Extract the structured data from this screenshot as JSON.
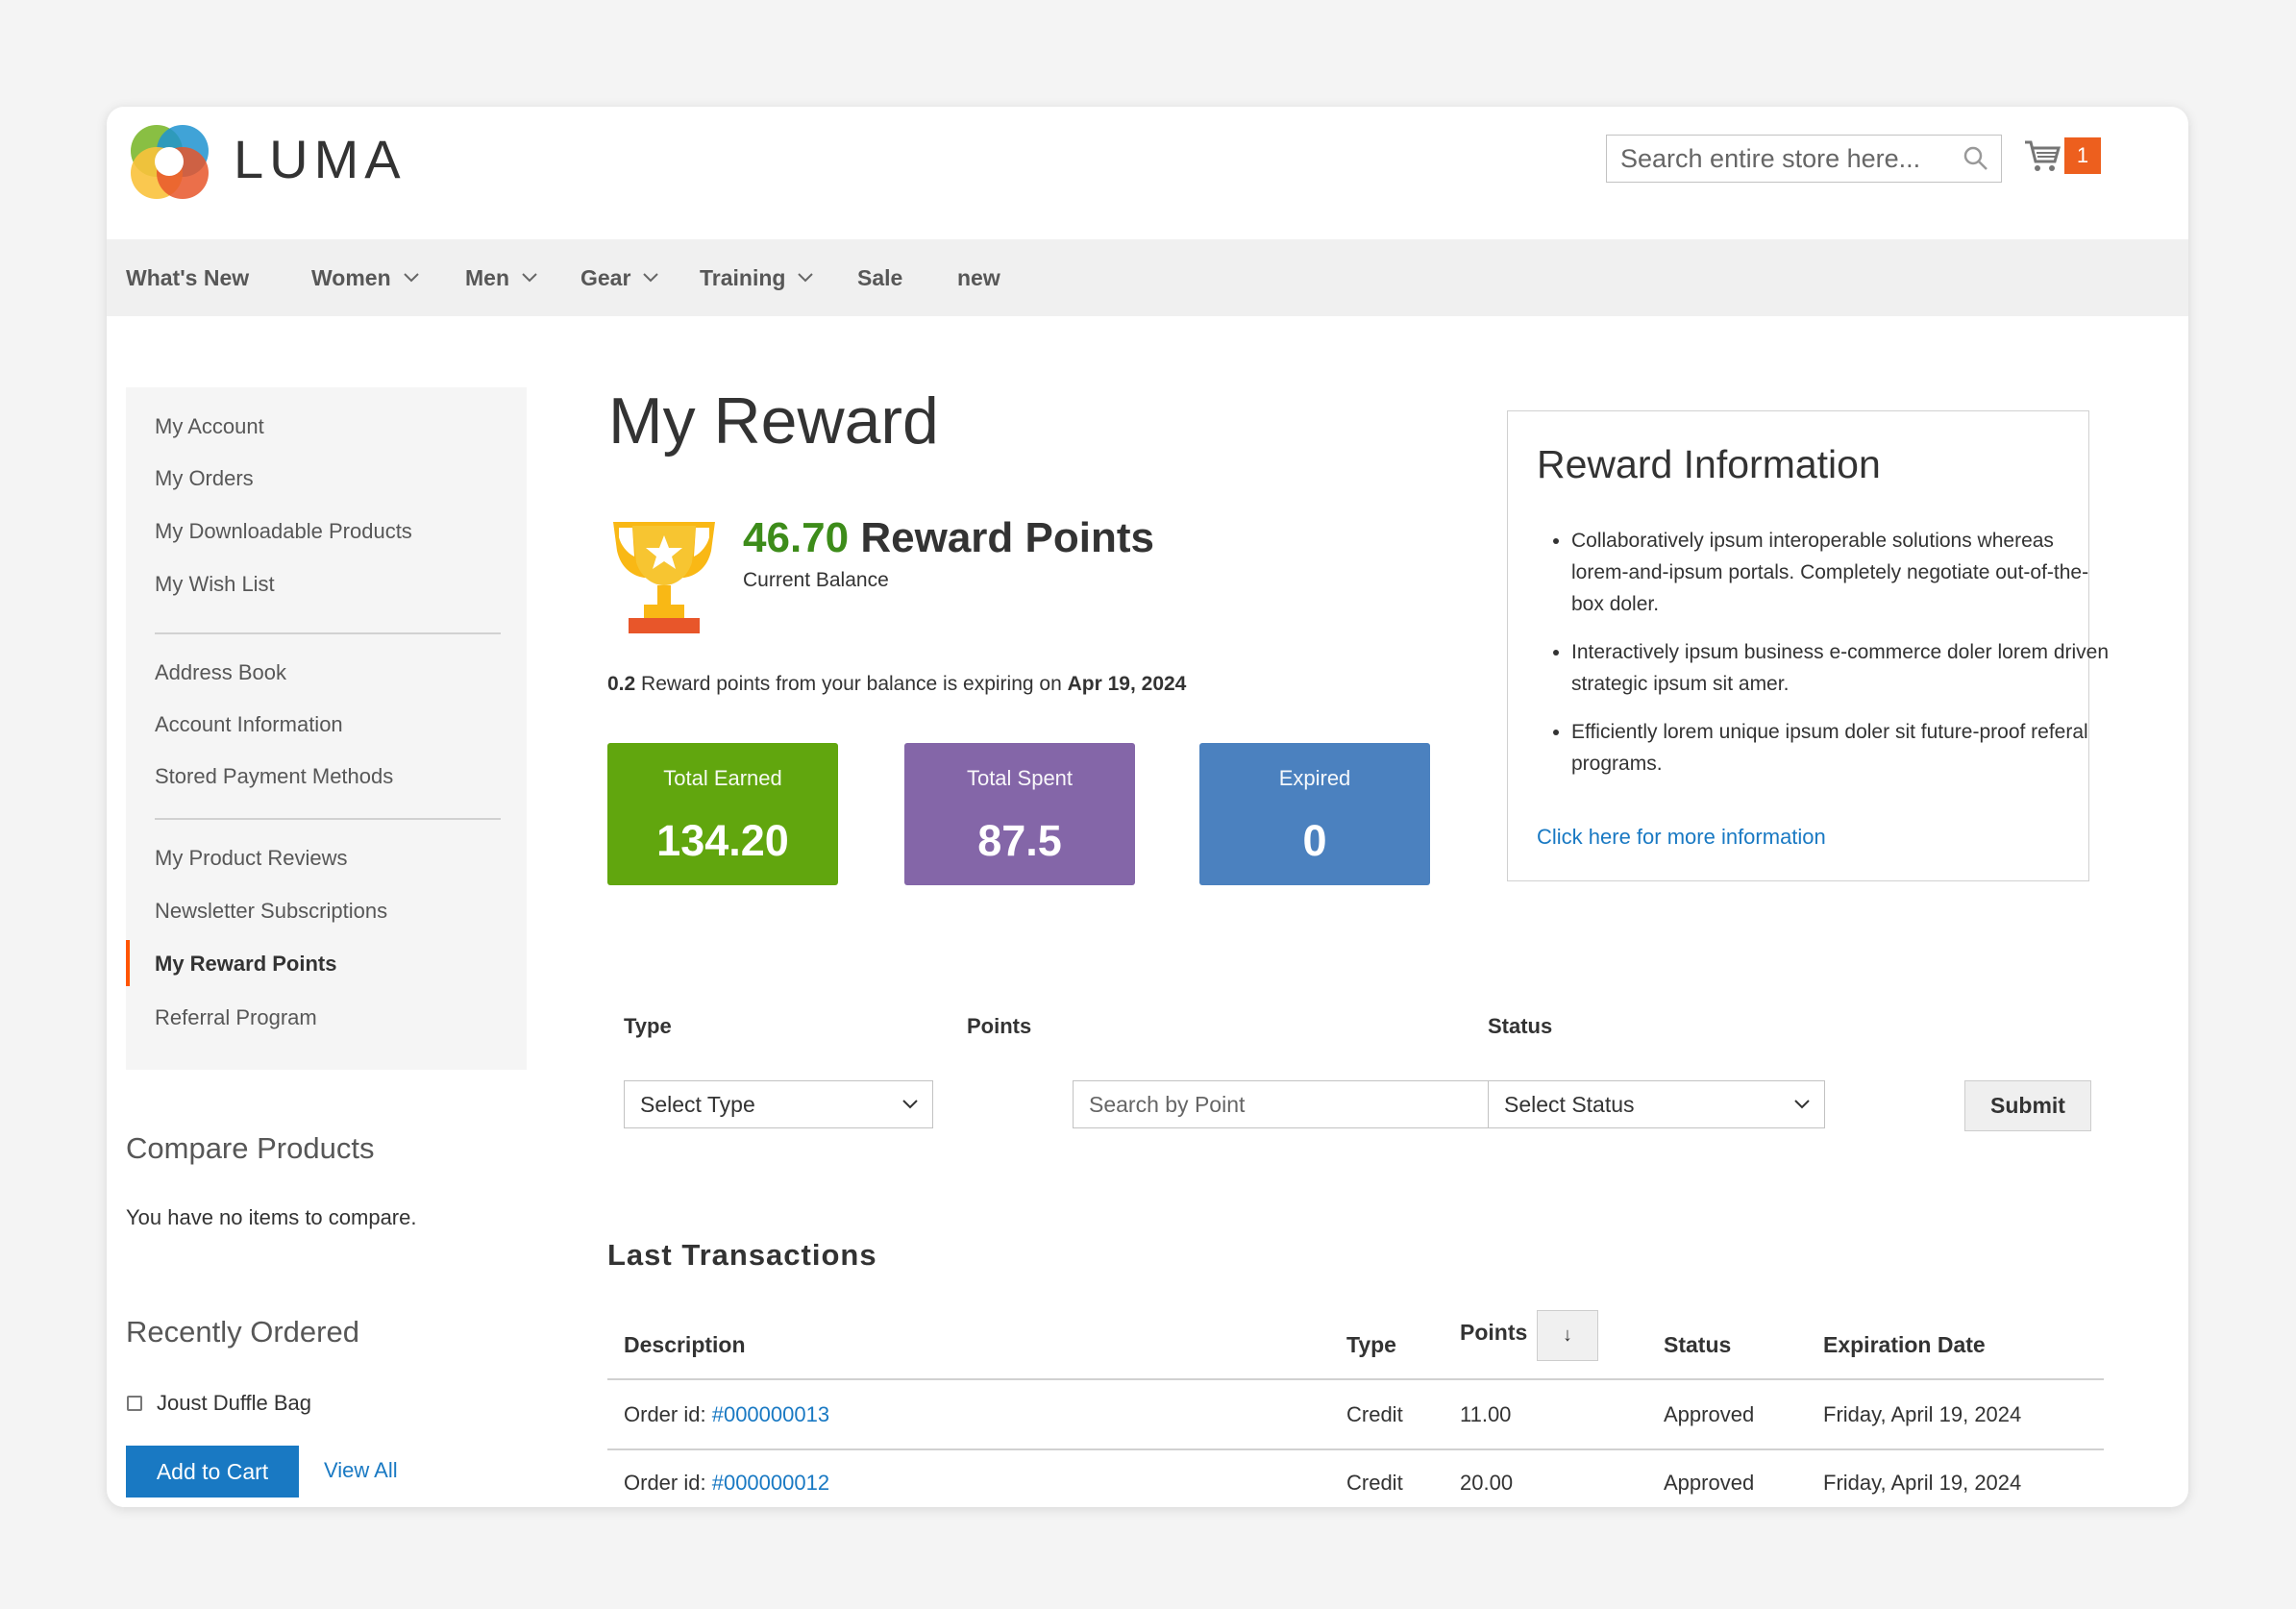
{
  "header": {
    "logo_text": "LUMA",
    "search_placeholder": "Search entire store here...",
    "cart_count": "1"
  },
  "nav": {
    "items": [
      {
        "label": "What's New",
        "has_dropdown": false
      },
      {
        "label": "Women",
        "has_dropdown": true
      },
      {
        "label": "Men",
        "has_dropdown": true
      },
      {
        "label": "Gear",
        "has_dropdown": true
      },
      {
        "label": "Training",
        "has_dropdown": true
      },
      {
        "label": "Sale",
        "has_dropdown": false
      },
      {
        "label": "new",
        "has_dropdown": false
      }
    ]
  },
  "sidebar": {
    "items": [
      {
        "label": "My Account"
      },
      {
        "label": "My Orders"
      },
      {
        "label": "My Downloadable Products"
      },
      {
        "label": "My Wish List"
      },
      {
        "label": "Address Book"
      },
      {
        "label": "Account Information"
      },
      {
        "label": "Stored Payment Methods"
      },
      {
        "label": "My Product Reviews"
      },
      {
        "label": "Newsletter Subscriptions"
      },
      {
        "label": "My Reward Points",
        "active": true
      },
      {
        "label": "Referral Program"
      }
    ]
  },
  "compare": {
    "title": "Compare Products",
    "empty_text": "You have no items to compare."
  },
  "recently_ordered": {
    "title": "Recently Ordered",
    "item": "Joust Duffle Bag",
    "add_to_cart": "Add to Cart",
    "view_all": "View All"
  },
  "main": {
    "title": "My Reward",
    "balance_value": "46.70",
    "balance_unit": "Reward Points",
    "balance_label": "Current Balance",
    "expire_amount": "0.2",
    "expire_text": "Reward points from your balance is expiring on",
    "expire_date": "Apr 19, 2024"
  },
  "stats": [
    {
      "label": "Total Earned",
      "value": "134.20",
      "color": "#61a60e"
    },
    {
      "label": "Total Spent",
      "value": "87.5",
      "color": "#8466a8"
    },
    {
      "label": "Expired",
      "value": "0",
      "color": "#4b81bf"
    }
  ],
  "reward_info": {
    "title": "Reward Information",
    "bullets": [
      "Collaboratively ipsum interoperable solutions whereas lorem-and-ipsum portals. Completely negotiate out-of-the-box doler.",
      "Interactively ipsum business e-commerce doler lorem driven strategic ipsum sit amer.",
      "Efficiently lorem unique ipsum doler sit future-proof referal programs."
    ],
    "link": "Click here for more information"
  },
  "filter": {
    "type_label": "Type",
    "type_value": "Select Type",
    "points_label": "Points",
    "points_placeholder": "Search by Point",
    "status_label": "Status",
    "status_value": "Select Status",
    "submit": "Submit"
  },
  "transactions": {
    "title": "Last Transactions",
    "columns": [
      "Description",
      "Type",
      "Points",
      "Status",
      "Expiration Date"
    ],
    "sort_icon": "↓",
    "rows": [
      {
        "desc_prefix": "Order id:",
        "order": "#000000013",
        "type": "Credit",
        "points": "11.00",
        "status": "Approved",
        "expiration": "Friday, April 19, 2024"
      },
      {
        "desc_prefix": "Order id:",
        "order": "#000000012",
        "type": "Credit",
        "points": "20.00",
        "status": "Approved",
        "expiration": "Friday, April 19, 2024"
      }
    ]
  }
}
